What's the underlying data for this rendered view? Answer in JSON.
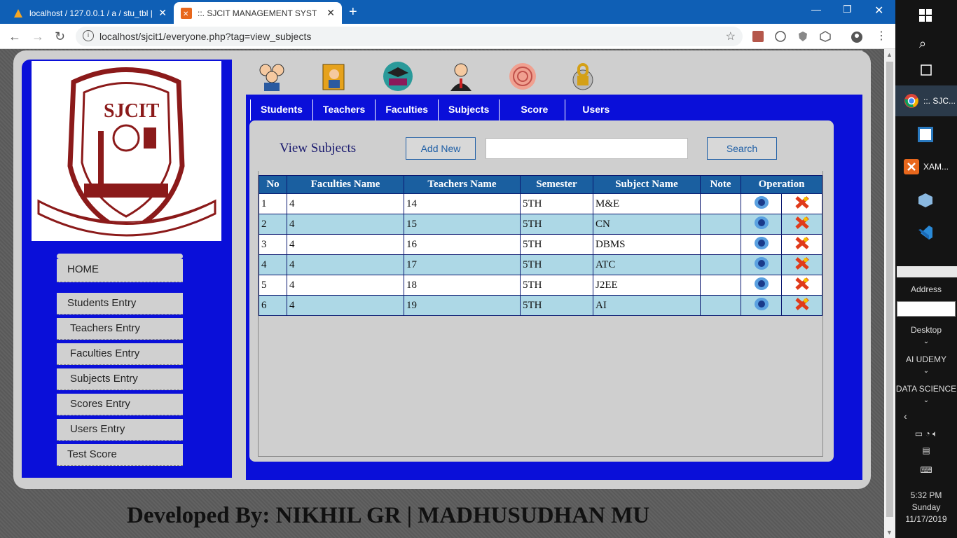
{
  "browser": {
    "tabs": [
      {
        "title": "localhost / 127.0.0.1 / a / stu_tbl |"
      },
      {
        "title": "::. SJCIT MANAGEMENT SYSTEM"
      }
    ],
    "url": "localhost/sjcit1/everyone.php?tag=view_subjects"
  },
  "sidebar": {
    "menu": [
      {
        "label": "HOME"
      },
      {
        "label": "Students Entry"
      },
      {
        "label": "Teachers Entry"
      },
      {
        "label": "Faculties Entry"
      },
      {
        "label": "Subjects Entry"
      },
      {
        "label": "Scores Entry"
      },
      {
        "label": "Users Entry"
      },
      {
        "label": "Test Score"
      }
    ]
  },
  "nav": {
    "links": [
      "Students",
      "Teachers",
      "Faculties",
      "Subjects",
      "Score",
      "Users"
    ]
  },
  "main": {
    "title": "View Subjects",
    "add_label": "Add New",
    "search_label": "Search",
    "search_value": "",
    "table": {
      "headers": [
        "No",
        "Faculties Name",
        "Teachers Name",
        "Semester",
        "Subject Name",
        "Note",
        "Operation"
      ],
      "rows": [
        {
          "no": "1",
          "faculty": "4",
          "teacher": "14",
          "semester": "5TH",
          "subject": "M&E",
          "note": ""
        },
        {
          "no": "2",
          "faculty": "4",
          "teacher": "15",
          "semester": "5TH",
          "subject": "CN",
          "note": ""
        },
        {
          "no": "3",
          "faculty": "4",
          "teacher": "16",
          "semester": "5TH",
          "subject": "DBMS",
          "note": ""
        },
        {
          "no": "4",
          "faculty": "4",
          "teacher": "17",
          "semester": "5TH",
          "subject": "ATC",
          "note": ""
        },
        {
          "no": "5",
          "faculty": "4",
          "teacher": "18",
          "semester": "5TH",
          "subject": "J2EE",
          "note": ""
        },
        {
          "no": "6",
          "faculty": "4",
          "teacher": "19",
          "semester": "5TH",
          "subject": "AI",
          "note": ""
        }
      ]
    }
  },
  "footer": {
    "text": "Developed By: NIKHIL GR | MADHUSUDHAN MU"
  },
  "taskbar": {
    "chrome_label": "::. SJC...",
    "xampp_label": "XAM...",
    "address_label": "Address",
    "toolbars": [
      "Desktop",
      "AI UDEMY",
      "DATA SCIENCE"
    ],
    "time": "5:32 PM",
    "day": "Sunday",
    "date": "11/17/2019"
  },
  "colors": {
    "brand_blue": "#0a0fd9",
    "header_blue": "#1a5fa0",
    "row_alt": "#add8e6",
    "panel_grey": "#cfcfcf"
  }
}
